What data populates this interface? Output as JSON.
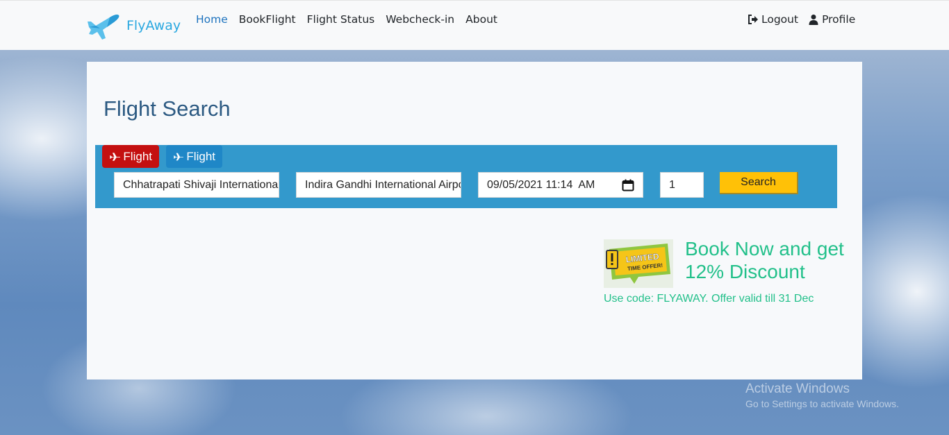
{
  "brand": {
    "name": "FlyAway"
  },
  "nav": {
    "links": [
      "Home",
      "BookFlight",
      "Flight Status",
      "Webcheck-in",
      "About"
    ],
    "logout": "Logout",
    "profile": "Profile"
  },
  "main": {
    "title": "Flight Search",
    "tabs": [
      "Flight",
      "Flight"
    ],
    "from": "Chhatrapati Shivaji International Airport",
    "to": "Indira Gandhi International Airport",
    "date": "09/05/2021 11:14  AM",
    "passengers": "1",
    "search_label": "Search"
  },
  "offer": {
    "badge_line1": "LIMITED",
    "badge_line2": "TIME OFFER!",
    "headline": "Book Now and get 12% Discount",
    "code_text": "Use code: FLYAWAY. Offer valid till 31 Dec"
  },
  "watermark": {
    "line1": "Activate Windows",
    "line2": "Go to Settings to activate Windows."
  },
  "colors": {
    "accent": "#3399cc",
    "tab_active": "#c41010",
    "button": "#ffc107",
    "offer_text": "#22c08a"
  }
}
